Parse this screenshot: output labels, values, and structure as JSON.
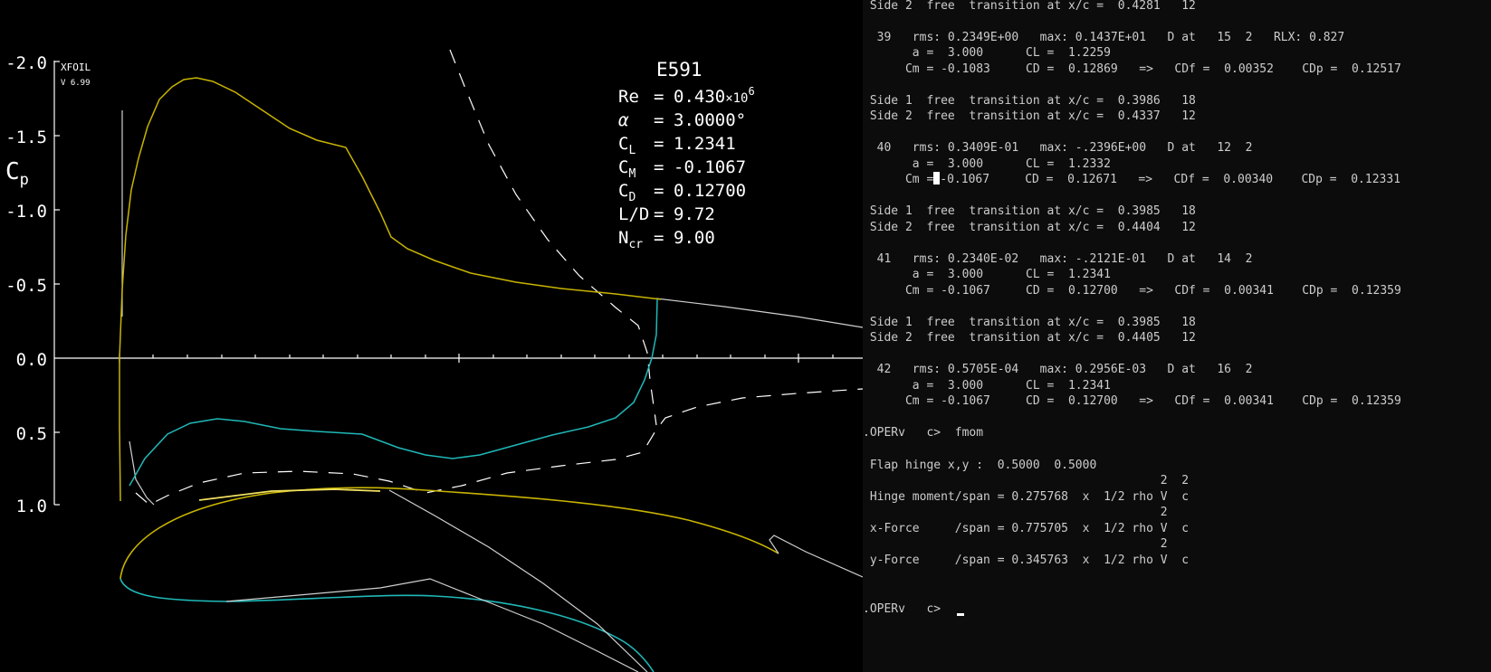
{
  "plot": {
    "program_name": "XFOIL",
    "program_version": "V 6.99",
    "cp_symbol": "C",
    "cp_subscript": "p",
    "y_tick_labels": [
      "-2.0",
      "-1.5",
      "-1.0",
      "-0.5",
      "0.0",
      "0.5",
      "1.0"
    ],
    "airfoil_name": "E591",
    "info": {
      "re_label": "Re",
      "re_value": "0.430",
      "re_times": "×10",
      "re_exp": "6",
      "alpha_label": "α",
      "alpha_value": "3.0000°",
      "cl_label": "C",
      "cl_sub": "L",
      "cl_value": "1.2341",
      "cm_label": "C",
      "cm_sub": "M",
      "cm_value": "-0.1067",
      "cd_label": "C",
      "cd_sub": "D",
      "cd_value": "0.12700",
      "ld_label": "L/D",
      "ld_value": "9.72",
      "ncr_label": "N",
      "ncr_sub": "cr",
      "ncr_value": "9.00",
      "equals": "="
    },
    "colors": {
      "background": "#000000",
      "axes": "#ffffff",
      "inviscid_cp": "#c8b400",
      "upper_surface": "#c8b400",
      "lower_surface": "#20b8b8",
      "reference": "#d0d0d0"
    }
  },
  "terminal": {
    "colors": {
      "background": "#0c0c0c",
      "text": "#cccccc"
    },
    "lines": [
      " Side 2  free  transition at x/c =  0.4281   12",
      "",
      "  39   rms: 0.2349E+00   max: 0.1437E+01   D at   15  2   RLX: 0.827",
      "       a =  3.000      CL =  1.2259",
      "      Cm = -0.1083     CD =  0.12869   =>   CDf =  0.00352    CDp =  0.12517",
      "",
      " Side 1  free  transition at x/c =  0.3986   18",
      " Side 2  free  transition at x/c =  0.4337   12",
      "",
      "  40   rms: 0.3409E-01   max: -.2396E+00   D at   12  2",
      "       a =  3.000      CL =  1.2332",
      "      Cm =",
      "",
      " Side 1  free  transition at x/c =  0.3985   18",
      " Side 2  free  transition at x/c =  0.4404   12",
      "",
      "  41   rms: 0.2340E-02   max: -.2121E-01   D at   14  2",
      "       a =  3.000      CL =  1.2341",
      "      Cm = -0.1067     CD =  0.12700   =>   CDf =  0.00341    CDp =  0.12359",
      "",
      " Side 1  free  transition at x/c =  0.3985   18",
      " Side 2  free  transition at x/c =  0.4405   12",
      "",
      "  42   rms: 0.5705E-04   max: 0.2956E-03   D at   16  2",
      "       a =  3.000      CL =  1.2341",
      "      Cm = -0.1067     CD =  0.12700   =>   CDf =  0.00341    CDp =  0.12359",
      "",
      ".OPERv   c>  fmom",
      "",
      " Flap hinge x,y :  0.5000  0.5000",
      "                                          2  2",
      " Hinge moment/span = 0.275768  x  1/2 rho V  c",
      "                                          2",
      " x-Force     /span = 0.775705  x  1/2 rho V  c",
      "                                          2",
      " y-Force     /span = 0.345763  x  1/2 rho V  c",
      "",
      "",
      ".OPERv   c>"
    ],
    "cursor_line_rest": "-0.1067     CD =  0.12671   =>   CDf =  0.00340    CDp =  0.12331"
  }
}
